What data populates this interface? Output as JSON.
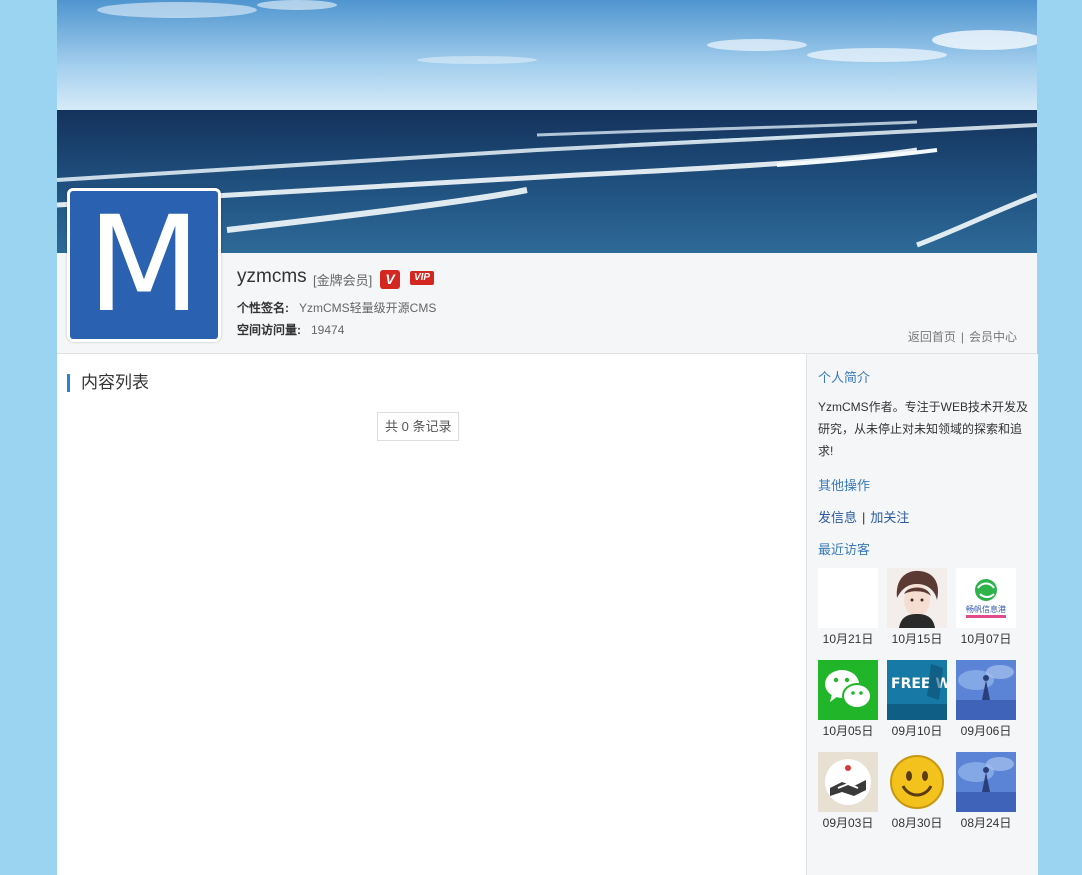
{
  "profile": {
    "avatar_letter": "M",
    "username": "yzmcms",
    "level": "[金牌会员]",
    "badge_v": "V",
    "badge_vip": "VIP",
    "signature_label": "个性签名:",
    "signature": "YzmCMS轻量级开源CMS",
    "visits_label": "空间访问量:",
    "visits": "19474"
  },
  "top_links": {
    "home": "返回首页",
    "separator": "|",
    "member": "会员中心"
  },
  "main": {
    "title": "内容列表",
    "pager": "共 0 条记录",
    "accent_color": "#2e82d8"
  },
  "sidebar": {
    "bio_title": "个人简介",
    "bio": "YzmCMS作者。专注于WEB技术开发及研究，从未停止对未知领域的探索和追求!",
    "ops_title": "其他操作",
    "ops": [
      "发信息",
      "加关注"
    ],
    "ops_separator": "|",
    "visitors_title": "最近访客",
    "visitors": [
      {
        "date": "10月21日",
        "icon": "blank-avatar-icon"
      },
      {
        "date": "10月15日",
        "icon": "anime-boy-avatar-icon"
      },
      {
        "date": "10月07日",
        "icon": "globe-logo-avatar-icon",
        "logo_text": "畅帆信息港"
      },
      {
        "date": "10月05日",
        "icon": "wechat-avatar-icon"
      },
      {
        "date": "09月10日",
        "icon": "free-hosting-avatar-icon",
        "logo_text": "FREE WEB HOSTING"
      },
      {
        "date": "09月06日",
        "icon": "blue-scene-avatar-icon"
      },
      {
        "date": "09月03日",
        "icon": "handshake-avatar-icon"
      },
      {
        "date": "08月30日",
        "icon": "smiley-avatar-icon"
      },
      {
        "date": "08月24日",
        "icon": "blue-scene-avatar-icon"
      }
    ]
  },
  "colors": {
    "page_bg": "#9bd4f1",
    "avatar_bg": "#2a61b0",
    "link": "#3a7ab8",
    "badge": "#d3271f"
  }
}
